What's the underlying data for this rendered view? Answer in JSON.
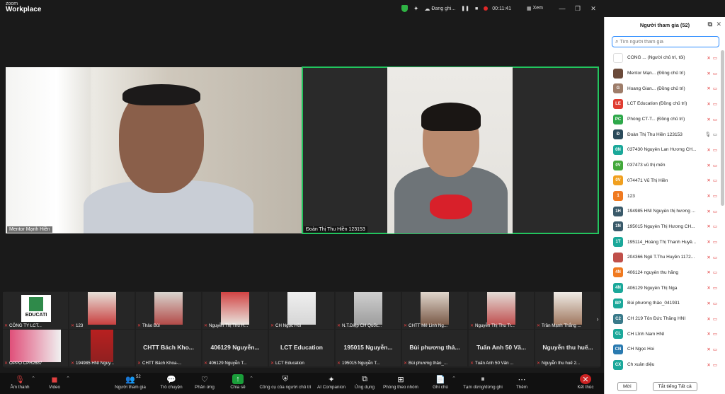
{
  "app": {
    "brand_small": "zoom",
    "brand_large": "Workplace"
  },
  "titlebar": {
    "recording": "Đang ghi...",
    "timer": "00:11:41",
    "view": "Xem"
  },
  "speakers": [
    {
      "name": "Mentor Mạnh Hiền"
    },
    {
      "name": "Đoàn Thị Thu Hiền 123153"
    }
  ],
  "strip_row1": [
    {
      "label": "CÔNG TY LCT..."
    },
    {
      "label": "123"
    },
    {
      "label": "Thảo Bùi"
    },
    {
      "label": "Nguyễn Thị Thu H..."
    },
    {
      "label": "CH Ngọc Hồi"
    },
    {
      "label": "N.T.Diệp CH Quốc..."
    },
    {
      "label": "CHTT Mê Linh Ng..."
    },
    {
      "label": "Nguyễn Thị Thu Tr..."
    },
    {
      "label": "Trần Mạnh Thắng ..."
    }
  ],
  "strip_row2": [
    {
      "label": "OPPO CPH2687",
      "name": ""
    },
    {
      "label": "194985 HNI Nguy...",
      "name": ""
    },
    {
      "label": "CHTT Bách Khoa-...",
      "name": "CHTT Bách Kho..."
    },
    {
      "label": "406129 Nguyễn T...",
      "name": "406129 Nguyễn..."
    },
    {
      "label": "LCT Education",
      "name": "LCT Education"
    },
    {
      "label": "195015 Nguyễn T...",
      "name": "195015 Nguyễn..."
    },
    {
      "label": "Bùi phương thảo_...",
      "name": "Bùi phương thả..."
    },
    {
      "label": "Tuấn Anh 50 Văn ...",
      "name": "Tuấn Anh 50 Vă..."
    },
    {
      "label": "Nguyễn thu huế 2...",
      "name": "Nguyễn thu huế..."
    }
  ],
  "strip_logo_text": "EDUCATI",
  "toolbar": {
    "audio": "Âm thanh",
    "video": "Video",
    "participants": "Người tham gia",
    "participants_count": "52",
    "chat": "Trò chuyện",
    "react": "Phản ứng",
    "share": "Chia sẻ",
    "host_tools": "Công cụ của người chủ trì",
    "ai": "AI Companion",
    "apps": "Ứng dụng",
    "rooms": "Phòng theo nhóm",
    "notes": "Ghi chú",
    "pause": "Tạm dừng/dừng ghi",
    "more": "Thêm",
    "end": "Kết thúc"
  },
  "panel": {
    "title": "Người tham gia (52)",
    "search_placeholder": "Tìm người tham gia",
    "invite": "Mời",
    "mute_all": "Tắt tiếng Tất cả",
    "participants": [
      {
        "initials": "",
        "color": "#ffffff",
        "name": "CÔNG ... (Người chủ trì, tôi)"
      },
      {
        "initials": "",
        "color": "#6b4a3a",
        "name": "Mentor Mạn... (Đồng chủ trì)"
      },
      {
        "initials": "G",
        "color": "#9e7d6a",
        "name": "Hoang Gian... (Đồng chủ trì)"
      },
      {
        "initials": "LE",
        "color": "#e03c31",
        "name": "LCT Education (Đồng chủ trì)"
      },
      {
        "initials": "PC",
        "color": "#2ea84a",
        "name": "Phòng CT-T... (Đồng chủ trì)"
      },
      {
        "initials": "Đ",
        "color": "#2a4a5a",
        "name": "Đoàn Thị Thu Hiền 123153"
      },
      {
        "initials": "0N",
        "color": "#1ba89a",
        "name": "037430 Nguyễn Lan Hương CH..."
      },
      {
        "initials": "0V",
        "color": "#42a83a",
        "name": "037473  vũ thị mến"
      },
      {
        "initials": "0V",
        "color": "#f0a020",
        "name": "074471 Vũ Thị Hiền"
      },
      {
        "initials": "1",
        "color": "#f07a20",
        "name": "123"
      },
      {
        "initials": "1H",
        "color": "#3a5a6a",
        "name": "194985 HNI Nguyễn thị hương ..."
      },
      {
        "initials": "1N",
        "color": "#3a5a6a",
        "name": "195015 Nguyễn Thị Hương CH..."
      },
      {
        "initials": "1T",
        "color": "#1ba89a",
        "name": "195114_Hoàng Thị Thanh Huyề..."
      },
      {
        "initials": "",
        "color": "#c0504a",
        "name": "204366 Ngô T.Thu Huyền 1172..."
      },
      {
        "initials": "4N",
        "color": "#f07a20",
        "name": "406124 nguyễn thu hằng"
      },
      {
        "initials": "4N",
        "color": "#1ba89a",
        "name": "406129 Nguyễn Thị Nga"
      },
      {
        "initials": "BP",
        "color": "#1ba89a",
        "name": "Bùi phương thảo_041931"
      },
      {
        "initials": "C2",
        "color": "#3a7a8a",
        "name": "CH 219 Tôn Đức Thắng HNI"
      },
      {
        "initials": "CL",
        "color": "#1ba89a",
        "name": "CH Lĩnh Nam HNI"
      },
      {
        "initials": "CN",
        "color": "#2a7ab0",
        "name": "CH Ngọc Hoi"
      },
      {
        "initials": "CX",
        "color": "#1ba89a",
        "name": "Ch xuân diệu"
      }
    ]
  }
}
